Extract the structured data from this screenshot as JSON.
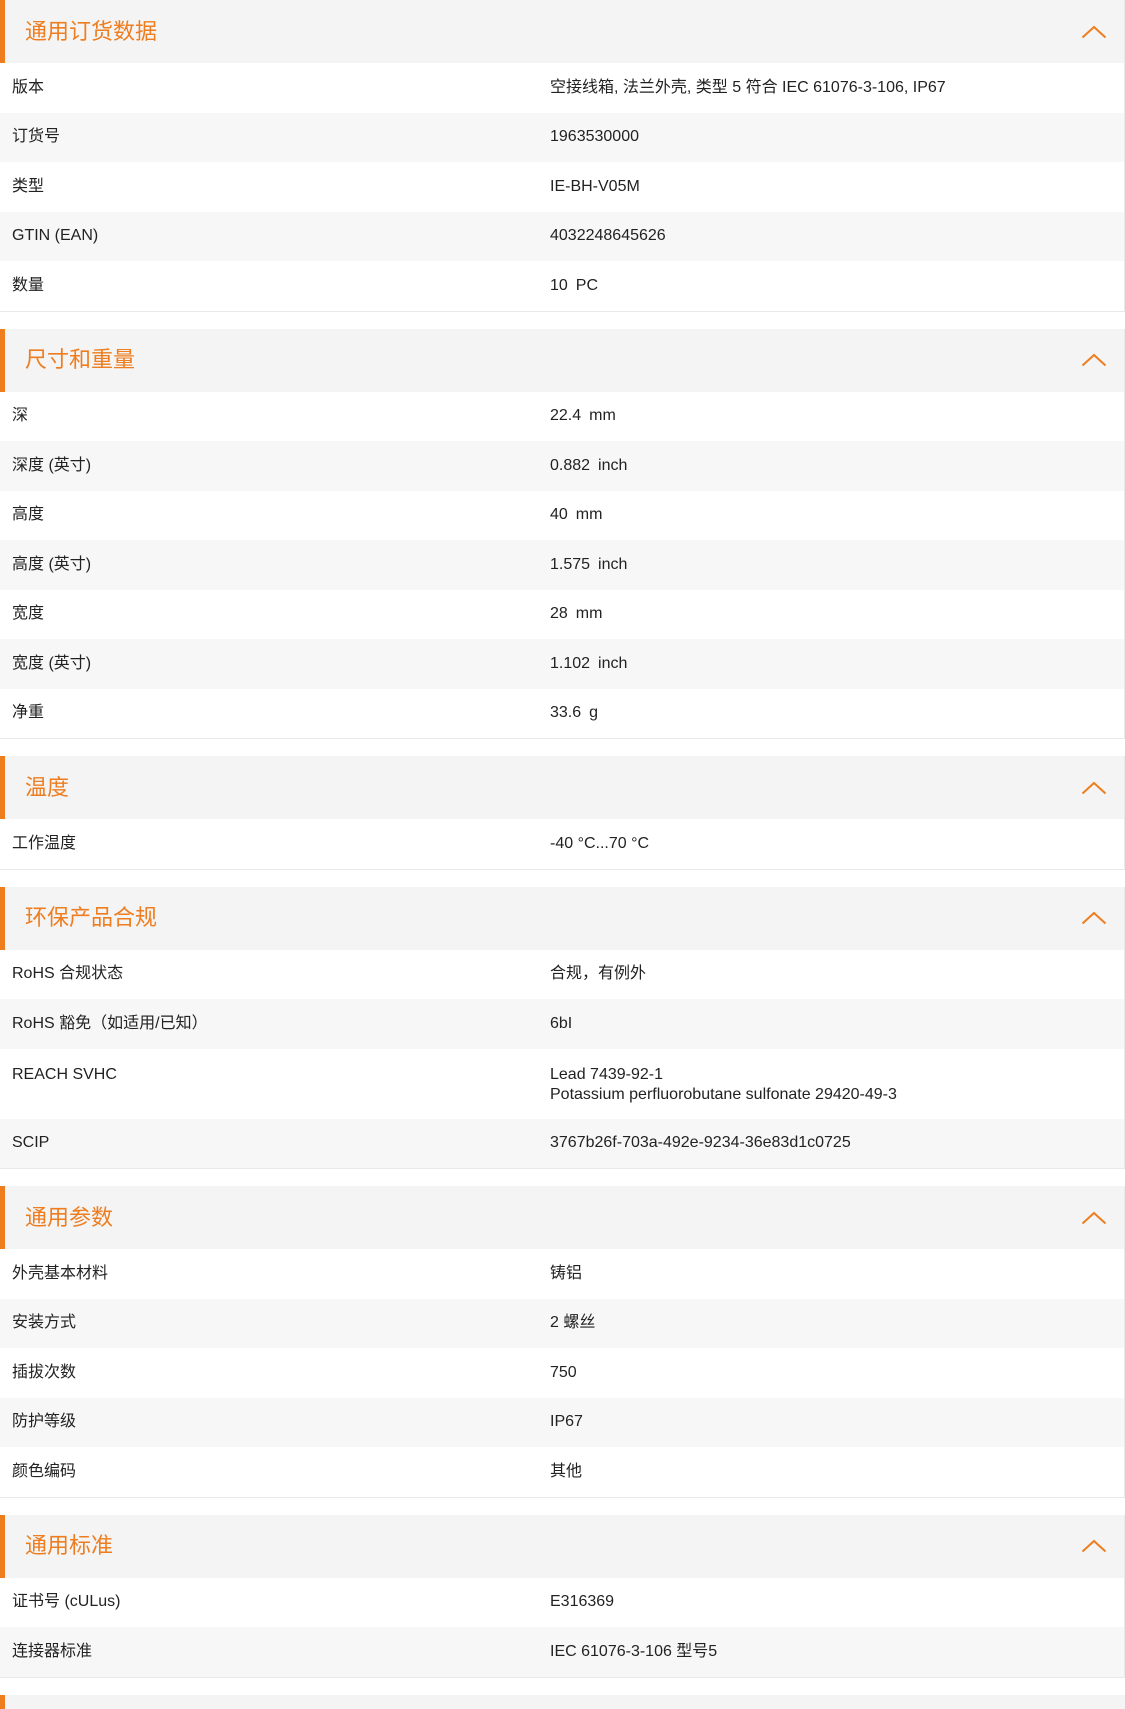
{
  "colors": {
    "accent": "#ee7d1f",
    "header_bg": "#f4f4f4",
    "alt_row_bg": "#f7f7f7"
  },
  "icons": {
    "section_toggle": "chevron-up-icon"
  },
  "sections": [
    {
      "title": "通用订货数据",
      "rows": [
        {
          "label": "版本",
          "value": "空接线箱, 法兰外壳, 类型 5 符合 IEC 61076-3-106, IP67"
        },
        {
          "label": "订货号",
          "value": "1963530000"
        },
        {
          "label": "类型",
          "value": "IE-BH-V05M"
        },
        {
          "label": "GTIN (EAN)",
          "value": "4032248645626"
        },
        {
          "label": "数量",
          "value": "10",
          "unit": "PC"
        }
      ]
    },
    {
      "title": "尺寸和重量",
      "rows": [
        {
          "label": "深",
          "value": "22.4",
          "unit": "mm"
        },
        {
          "label": "深度 (英寸)",
          "value": "0.882",
          "unit": "inch"
        },
        {
          "label": "高度",
          "value": "40",
          "unit": "mm"
        },
        {
          "label": "高度 (英寸)",
          "value": "1.575",
          "unit": "inch"
        },
        {
          "label": "宽度",
          "value": "28",
          "unit": "mm"
        },
        {
          "label": "宽度 (英寸)",
          "value": "1.102",
          "unit": "inch"
        },
        {
          "label": "净重",
          "value": "33.6",
          "unit": "g"
        }
      ]
    },
    {
      "title": "温度",
      "rows": [
        {
          "label": "工作温度",
          "value": "-40 °C...70 °C"
        }
      ]
    },
    {
      "title": "环保产品合规",
      "rows": [
        {
          "label": "RoHS 合规状态",
          "value": "合规，有例外"
        },
        {
          "label": "RoHS 豁免（如适用/已知）",
          "value": "6bI"
        },
        {
          "label": "REACH SVHC",
          "values": [
            "Lead 7439-92-1",
            "Potassium perfluorobutane sulfonate 29420-49-3"
          ]
        },
        {
          "label": "SCIP",
          "value": "3767b26f-703a-492e-9234-36e83d1c0725"
        }
      ]
    },
    {
      "title": "通用参数",
      "rows": [
        {
          "label": "外壳基本材料",
          "value": "铸铝"
        },
        {
          "label": "安装方式",
          "value": "2 螺丝"
        },
        {
          "label": "插拔次数",
          "value": "750"
        },
        {
          "label": "防护等级",
          "value": "IP67"
        },
        {
          "label": "颜色编码",
          "value": "其他"
        }
      ]
    },
    {
      "title": "通用标准",
      "rows": [
        {
          "label": "证书号 (cULus)",
          "value": "E316369"
        },
        {
          "label": "连接器标准",
          "value": "IEC 61076-3-106 型号5"
        }
      ]
    }
  ]
}
